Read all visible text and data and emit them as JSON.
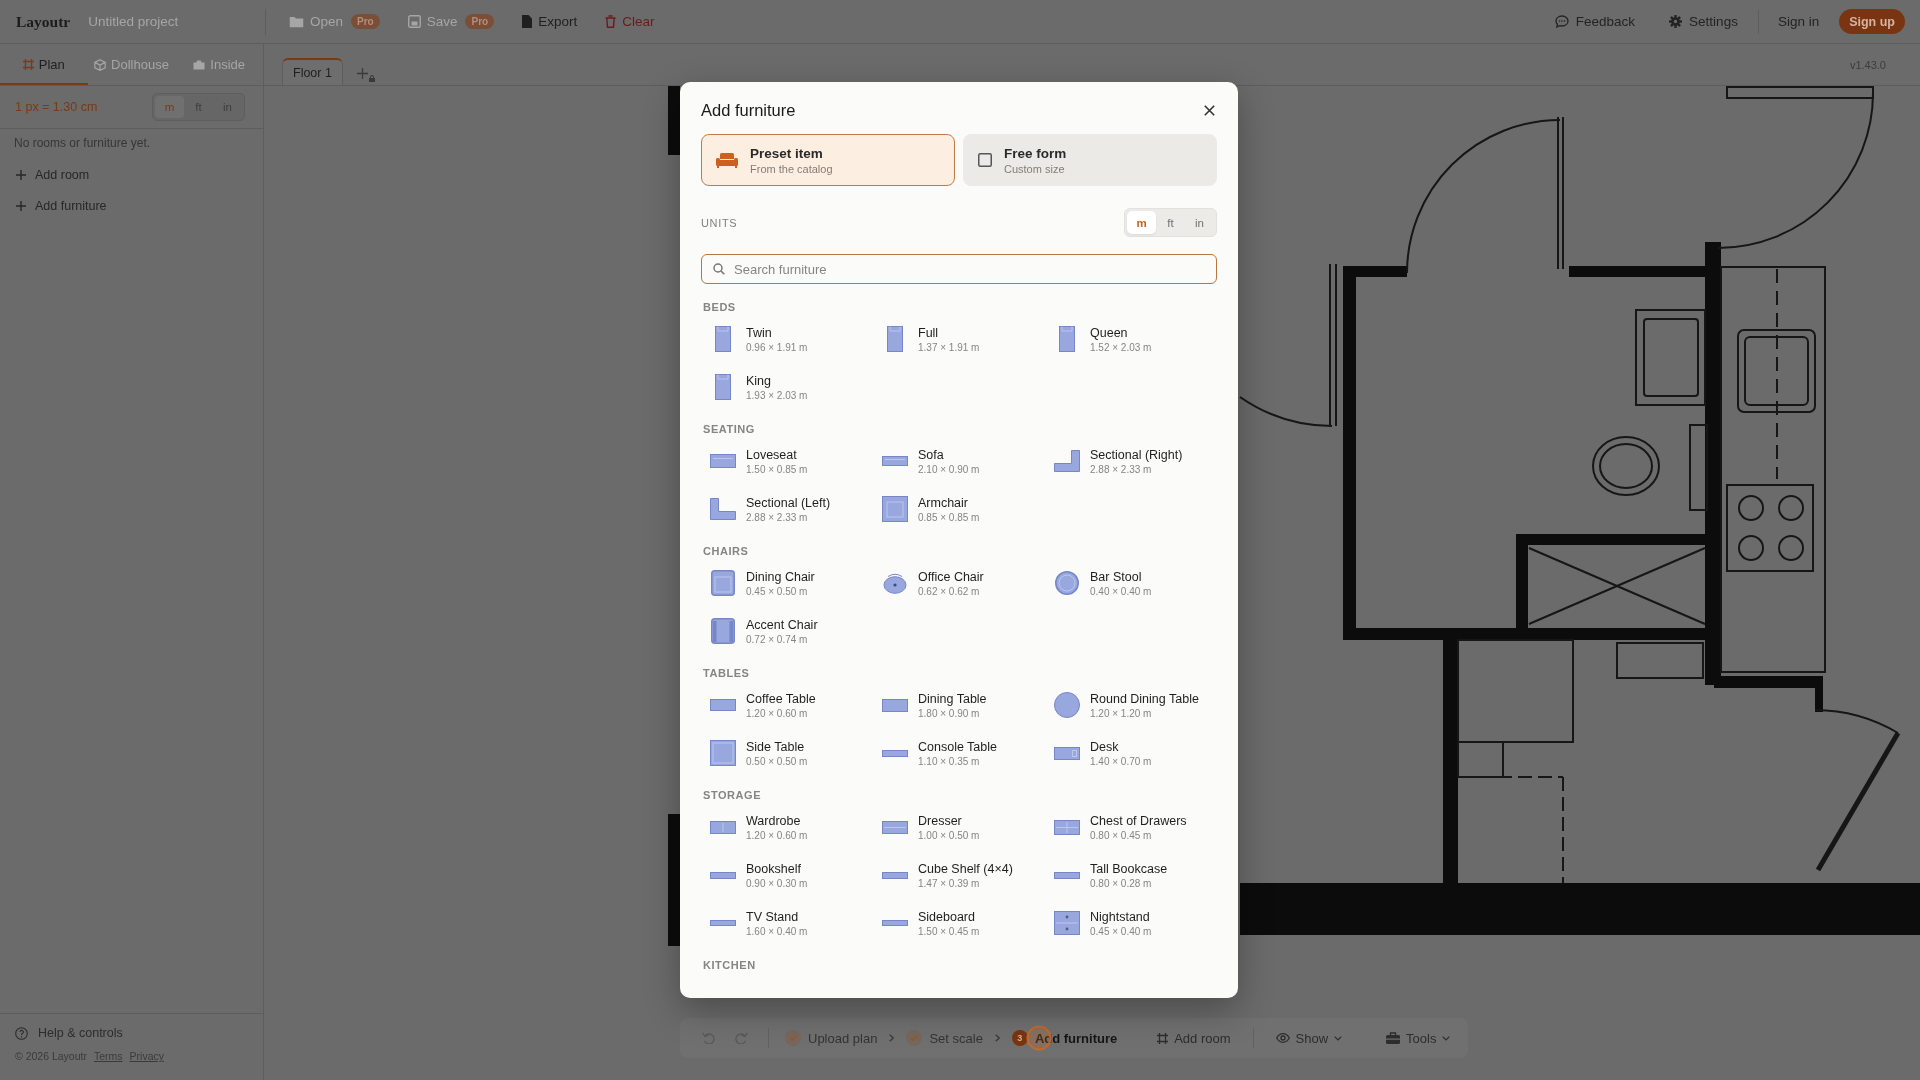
{
  "topbar": {
    "logo": "Layoutr",
    "project": "Untitled project",
    "actions": [
      {
        "label": "Open",
        "kind": "open",
        "badge": "Pro",
        "disabled": true
      },
      {
        "label": "Save",
        "kind": "save",
        "badge": "Pro",
        "disabled": true
      },
      {
        "label": "Export",
        "kind": "export",
        "disabled": false
      },
      {
        "label": "Clear",
        "kind": "clear",
        "disabled": false
      }
    ],
    "links": [
      {
        "label": "Feedback",
        "kind": "feedback"
      },
      {
        "label": "Settings",
        "kind": "settings"
      }
    ],
    "sign_in": "Sign in",
    "sign_up": "Sign up"
  },
  "sidebar": {
    "view_tabs": [
      {
        "label": "Plan",
        "kind": "plan",
        "selected": true,
        "disabled": false
      },
      {
        "label": "Dollhouse",
        "kind": "dollhouse",
        "selected": false,
        "disabled": true
      },
      {
        "label": "Inside",
        "kind": "inside",
        "selected": false,
        "disabled": true
      }
    ],
    "scale": "1 px = 1.30 cm",
    "units": [
      {
        "label": "m",
        "selected": true
      },
      {
        "label": "ft",
        "selected": false
      },
      {
        "label": "in",
        "selected": false
      }
    ],
    "empty_message": "No rooms or furniture yet.",
    "actions": [
      {
        "label": "Add room"
      },
      {
        "label": "Add furniture"
      }
    ],
    "help": "Help & controls",
    "footer": {
      "copyright": "© 2026 Layoutr",
      "links": [
        "Terms",
        "Privacy"
      ]
    }
  },
  "floors": {
    "tabs": [
      {
        "label": "Floor 1",
        "selected": true
      }
    ],
    "add_locked": true,
    "version": "v1.43.0"
  },
  "dialog": {
    "title": "Add furniture",
    "modes": [
      {
        "title": "Preset item",
        "subtitle": "From the catalog",
        "kind": "preset",
        "selected": true
      },
      {
        "title": "Free form",
        "subtitle": "Custom size",
        "kind": "free",
        "selected": false
      }
    ],
    "units_label": "UNITS",
    "units": [
      {
        "label": "m",
        "selected": true
      },
      {
        "label": "ft",
        "selected": false
      },
      {
        "label": "in",
        "selected": false
      }
    ],
    "search": {
      "placeholder": "Search furniture"
    },
    "sections": [
      {
        "heading": "BEDS",
        "items": [
          {
            "name": "Twin",
            "size": "0.96 × 1.91 m",
            "kind": "bed"
          },
          {
            "name": "Full",
            "size": "1.37 × 1.91 m",
            "kind": "bed"
          },
          {
            "name": "Queen",
            "size": "1.52 × 2.03 m",
            "kind": "bed"
          },
          {
            "name": "King",
            "size": "1.93 × 2.03 m",
            "kind": "bed"
          }
        ]
      },
      {
        "heading": "SEATING",
        "items": [
          {
            "name": "Loveseat",
            "size": "1.50 × 0.85 m",
            "kind": "loveseat"
          },
          {
            "name": "Sofa",
            "size": "2.10 × 0.90 m",
            "kind": "sofa"
          },
          {
            "name": "Sectional (Right)",
            "size": "2.88 × 2.33 m",
            "kind": "cornerright"
          },
          {
            "name": "Sectional (Left)",
            "size": "2.88 × 2.33 m",
            "kind": "cornerleft"
          },
          {
            "name": "Armchair",
            "size": "0.85 × 0.85 m",
            "kind": "armchair"
          }
        ]
      },
      {
        "heading": "CHAIRS",
        "items": [
          {
            "name": "Dining Chair",
            "size": "0.45 × 0.50 m",
            "kind": "diningchair"
          },
          {
            "name": "Office Chair",
            "size": "0.62 × 0.62 m",
            "kind": "officechair"
          },
          {
            "name": "Bar Stool",
            "size": "0.40 × 0.40 m",
            "kind": "stool"
          },
          {
            "name": "Accent Chair",
            "size": "0.72 × 0.74 m",
            "kind": "accentchair"
          }
        ]
      },
      {
        "heading": "TABLES",
        "items": [
          {
            "name": "Coffee Table",
            "size": "1.20 × 0.60 m",
            "kind": "coffeetable"
          },
          {
            "name": "Dining Table",
            "size": "1.80 × 0.90 m",
            "kind": "diningtable"
          },
          {
            "name": "Round Dining Table",
            "size": "1.20 × 1.20 m",
            "kind": "roundtable"
          },
          {
            "name": "Side Table",
            "size": "0.50 × 0.50 m",
            "kind": "sidetable"
          },
          {
            "name": "Console Table",
            "size": "1.10 × 0.35 m",
            "kind": "console"
          },
          {
            "name": "Desk",
            "size": "1.40 × 0.70 m",
            "kind": "desk"
          }
        ]
      },
      {
        "heading": "STORAGE",
        "items": [
          {
            "name": "Wardrobe",
            "size": "1.20 × 0.60 m",
            "kind": "wardrobe"
          },
          {
            "name": "Dresser",
            "size": "1.00 × 0.50 m",
            "kind": "dresser"
          },
          {
            "name": "Chest of Drawers",
            "size": "0.80 × 0.45 m",
            "kind": "drawers"
          },
          {
            "name": "Bookshelf",
            "size": "0.90 × 0.30 m",
            "kind": "shelf"
          },
          {
            "name": "Cube Shelf (4×4)",
            "size": "1.47 × 0.39 m",
            "kind": "shelf"
          },
          {
            "name": "Tall Bookcase",
            "size": "0.80 × 0.28 m",
            "kind": "shelf"
          },
          {
            "name": "TV Stand",
            "size": "1.60 × 0.40 m",
            "kind": "stand"
          },
          {
            "name": "Sideboard",
            "size": "1.50 × 0.45 m",
            "kind": "stand"
          },
          {
            "name": "Nightstand",
            "size": "0.45 × 0.40 m",
            "kind": "nightstand"
          }
        ]
      },
      {
        "heading": "KITCHEN"
      }
    ]
  },
  "toolbar": {
    "history": [
      {
        "kind": "undo",
        "disabled": true
      },
      {
        "kind": "redo",
        "disabled": true
      }
    ],
    "steps": [
      {
        "label": "Upload plan",
        "done": true,
        "selected": false
      },
      {
        "label": "Set scale",
        "done": true,
        "selected": false
      },
      {
        "label": "Add furniture",
        "done": false,
        "number": "3",
        "selected": true
      }
    ],
    "add_room": {
      "label": "Add room"
    },
    "menus": [
      {
        "label": "Show",
        "kind": "show",
        "dropdown": true
      },
      {
        "label": "Tools",
        "kind": "tools",
        "dropdown": true
      }
    ]
  }
}
